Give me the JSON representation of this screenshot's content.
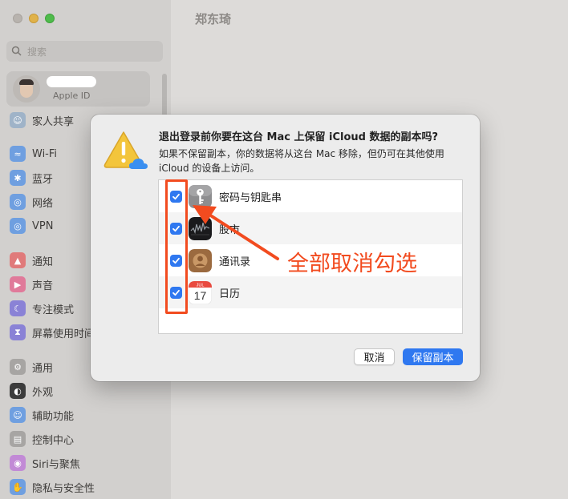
{
  "window": {
    "search_placeholder": "搜索",
    "apple_id_label": "Apple ID",
    "content_title": "郑东琦",
    "sidebar_items": [
      {
        "label": "家人共享",
        "icon": "family-icon",
        "color": "#9fb3c8"
      },
      {
        "label": "Wi-Fi",
        "icon": "wifi-icon",
        "color": "#6f9fe0"
      },
      {
        "label": "蓝牙",
        "icon": "bluetooth-icon",
        "color": "#6f9fe0"
      },
      {
        "label": "网络",
        "icon": "globe-icon",
        "color": "#6f9fe0"
      },
      {
        "label": "VPN",
        "icon": "vpn-icon",
        "color": "#6f9fe0"
      },
      {
        "label": "通知",
        "icon": "bell-icon",
        "color": "#e07a7a"
      },
      {
        "label": "声音",
        "icon": "speaker-icon",
        "color": "#e07a9a"
      },
      {
        "label": "专注模式",
        "icon": "moon-icon",
        "color": "#8a82d6"
      },
      {
        "label": "屏幕使用时间",
        "icon": "hourglass-icon",
        "color": "#8a82d6"
      },
      {
        "label": "通用",
        "icon": "gear-icon",
        "color": "#a7a5a3"
      },
      {
        "label": "外观",
        "icon": "appearance-icon",
        "color": "#3c3c3c"
      },
      {
        "label": "辅助功能",
        "icon": "accessibility-icon",
        "color": "#6f9fe0"
      },
      {
        "label": "控制中心",
        "icon": "control-center-icon",
        "color": "#a7a5a3"
      },
      {
        "label": "Siri与聚焦",
        "icon": "siri-icon",
        "color": "#c28ad6"
      },
      {
        "label": "隐私与安全性",
        "icon": "hand-icon",
        "color": "#6f9fe0"
      }
    ]
  },
  "dialog": {
    "title": "退出登录前你要在这台 Mac 上保留 iCloud 数据的副本吗?",
    "description": "如果不保留副本，你的数据将从这台 Mac 移除，但仍可在其他使用 iCloud 的设备上访问。",
    "items": [
      {
        "label": "密码与钥匙串",
        "icon": "keychain-icon",
        "checked": true
      },
      {
        "label": "股市",
        "icon": "stocks-icon",
        "checked": true
      },
      {
        "label": "通讯录",
        "icon": "contacts-icon",
        "checked": true
      },
      {
        "label": "日历",
        "icon": "calendar-icon",
        "checked": true,
        "calendar_month": "JUL",
        "calendar_day": "17"
      }
    ],
    "cancel_label": "取消",
    "keep_label": "保留副本",
    "accent": "#2f78f0"
  },
  "annotation": {
    "text": "全部取消勾选",
    "color": "#f24b1f"
  }
}
